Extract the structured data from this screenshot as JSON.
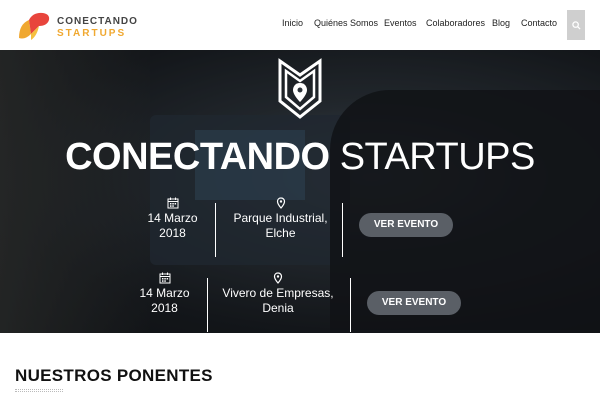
{
  "brand": {
    "name_line1": "CONECTANDO",
    "name_line2": "STARTUPS",
    "colors": {
      "orange": "#f0a830",
      "red": "#e8453c",
      "dark": "#444444"
    }
  },
  "nav": {
    "items": [
      {
        "label": "Inicio"
      },
      {
        "label": "Quiénes Somos"
      },
      {
        "label": "Eventos"
      },
      {
        "label": "Colaboradores"
      },
      {
        "label": "Blog"
      },
      {
        "label": "Contacto"
      }
    ],
    "search_icon": "search-icon"
  },
  "hero": {
    "title_bold": "CONECTANDO",
    "title_light": "STARTUPS",
    "emblem_icon": "location-shield-icon",
    "events": [
      {
        "date_line1": "14 Marzo",
        "date_line2": "2018",
        "place_line1": "Parque Industrial,",
        "place_line2": "Elche",
        "button_label": "VER EVENTO"
      },
      {
        "date_line1": "14 Marzo",
        "date_line2": "2018",
        "place_line1": "Vivero de Empresas,",
        "place_line2": "Denia",
        "button_label": "VER EVENTO"
      }
    ]
  },
  "section": {
    "title": "NUESTROS PONENTES"
  }
}
